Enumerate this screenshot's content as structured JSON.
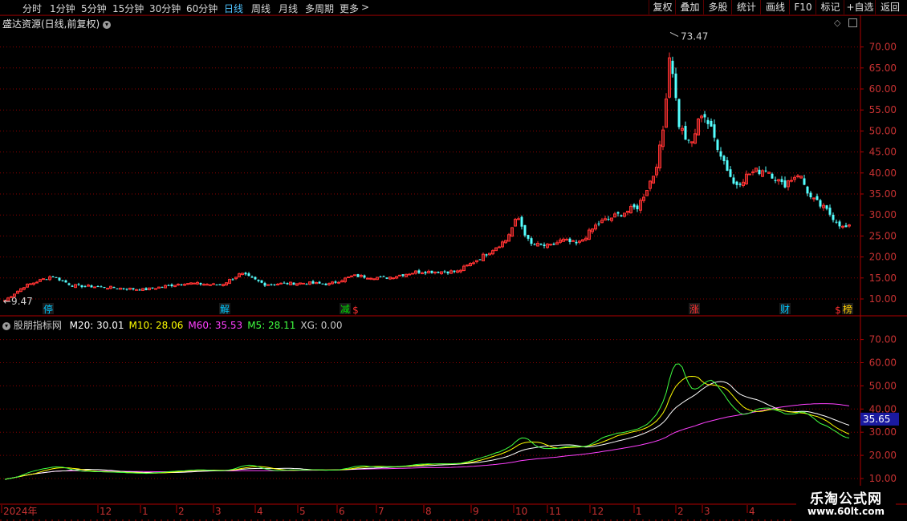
{
  "toolbar": {
    "periods": [
      "分时",
      "1分钟",
      "5分钟",
      "15分钟",
      "30分钟",
      "60分钟",
      "日线",
      "周线",
      "月线",
      "多周期",
      "更多"
    ],
    "active_period": "日线",
    "right_buttons": [
      "复权",
      "叠加",
      "多股",
      "统计",
      "画线",
      "F10",
      "标记",
      "+自选",
      "返回"
    ]
  },
  "main_panel": {
    "title": "盛达资源(日线,前复权)",
    "high_label": "73.47",
    "low_label": "9.47",
    "y_ticks": [
      "70.00",
      "65.00",
      "60.00",
      "55.00",
      "50.00",
      "45.00",
      "40.00",
      "35.00",
      "30.00",
      "25.00",
      "20.00",
      "15.00",
      "10.00"
    ],
    "markers": [
      {
        "text": "停",
        "color": "#00c8ff"
      },
      {
        "text": "解",
        "color": "#00c8ff"
      },
      {
        "text": "减",
        "color": "#00e000"
      },
      {
        "text": "$",
        "color": "#ff3030"
      },
      {
        "text": "涨",
        "color": "#ff3030"
      },
      {
        "text": "财",
        "color": "#00c8ff"
      },
      {
        "text": "$",
        "color": "#ff3030"
      },
      {
        "text": "榜",
        "color": "#ffd000"
      }
    ]
  },
  "indicator_panel": {
    "name": "股朋指标网",
    "values": [
      {
        "label": "M20",
        "value": "30.01",
        "color": "#ffffff"
      },
      {
        "label": "M10",
        "value": "28.06",
        "color": "#ffff00"
      },
      {
        "label": "M60",
        "value": "35.53",
        "color": "#ff40ff"
      },
      {
        "label": "M5",
        "value": "28.11",
        "color": "#40ff40"
      },
      {
        "label": "XG",
        "value": "0.00",
        "color": "#c8c8c8"
      }
    ],
    "y_ticks": [
      "70.00",
      "60.00",
      "50.00",
      "40.00",
      "30.00",
      "20.00",
      "10.00"
    ],
    "current_value": "35.65"
  },
  "x_axis": {
    "labels": [
      "2024年",
      "12",
      "1",
      "2",
      "3",
      "4",
      "5",
      "6",
      "7",
      "8",
      "9",
      "10",
      "11",
      "12",
      "1",
      "2",
      "3",
      "4"
    ]
  },
  "colors": {
    "up": "#ff3232",
    "down": "#54ffff",
    "grid": "#8b0000",
    "axis_text": "#c83232"
  },
  "watermark": {
    "title": "乐淘公式网",
    "url": "www.60lt.com"
  }
}
